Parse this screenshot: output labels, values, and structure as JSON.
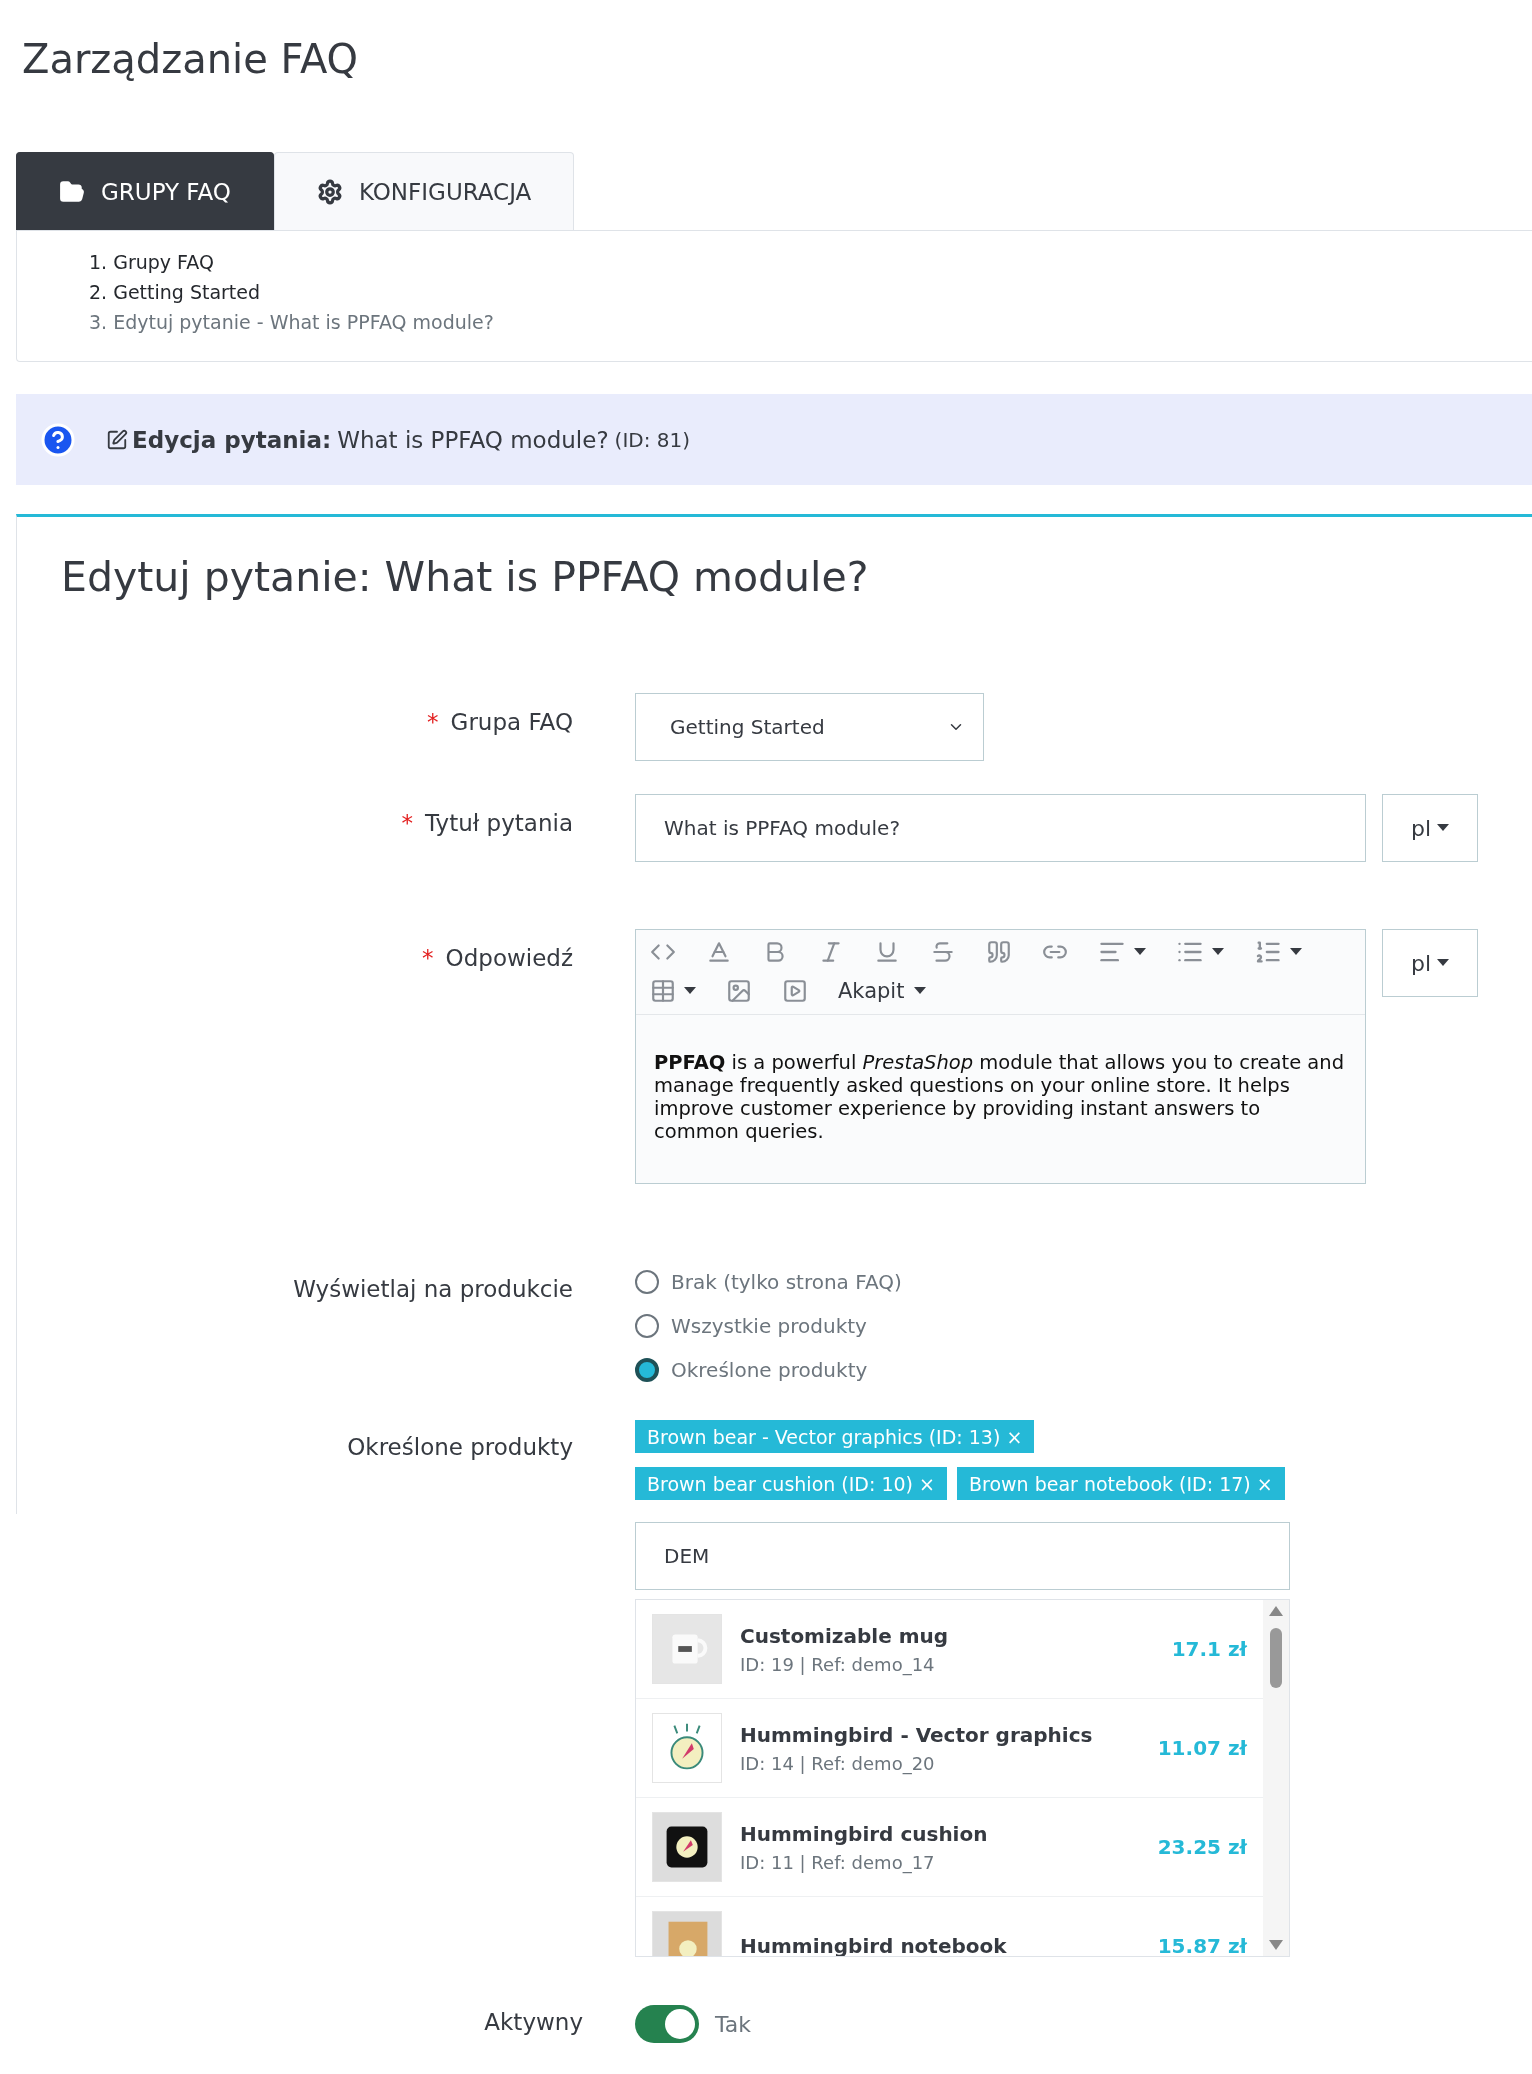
{
  "page_title": "Zarządzanie FAQ",
  "tabs": [
    {
      "label": "GRUPY FAQ",
      "selected": true
    },
    {
      "label": "KONFIGURACJA",
      "selected": false
    }
  ],
  "breadcrumb": [
    {
      "label": "1. Grupy FAQ",
      "current": false
    },
    {
      "label": "2. Getting Started",
      "current": false
    },
    {
      "label": "3. Edytuj pytanie - What is PPFAQ module?",
      "current": true
    }
  ],
  "info_banner": {
    "label": "Edycja pytania:",
    "title": "What is PPFAQ module?",
    "id": "(ID: 81)"
  },
  "form": {
    "heading": "Edytuj pytanie: What is PPFAQ module?",
    "group_field": {
      "label": "Grupa FAQ",
      "required_mark": "*",
      "value": "Getting Started"
    },
    "title_field": {
      "label": "Tytuł pytania",
      "required_mark": "*",
      "value": "What is PPFAQ module?",
      "language": "pl"
    },
    "answer_field": {
      "label": "Odpowiedź",
      "required_mark": "*",
      "format": "Akapit",
      "content": "**PPFAQ** is a powerful *PrestaShop* module that allows you to create and manage frequently asked questions on your online store. It helps improve customer experience by providing instant answers to common queries.",
      "language": "pl"
    },
    "display_field": {
      "label": "Wyświetlaj na produkcie",
      "options": [
        {
          "label": "Brak (tylko strona FAQ)",
          "selected": false
        },
        {
          "label": "Wszystkie produkty",
          "selected": false
        },
        {
          "label": "Określone produkty",
          "selected": true
        }
      ]
    },
    "products_field": {
      "label": "Określone produkty",
      "tags": [
        {
          "label": "Brown bear - Vector graphics (ID: 13)",
          "remove": "×"
        },
        {
          "label": "Brown bear cushion (ID: 10)",
          "remove": "×"
        },
        {
          "label": "Brown bear notebook (ID: 17)",
          "remove": "×"
        }
      ],
      "search": "DEM",
      "results": [
        {
          "name": "Customizable mug",
          "meta": "ID: 19 | Ref: demo_14",
          "price": "17.1 zł"
        },
        {
          "name": "Hummingbird - Vector graphics",
          "meta": "ID: 14 | Ref: demo_20",
          "price": "11.07 zł"
        },
        {
          "name": "Hummingbird cushion",
          "meta": "ID: 11 | Ref: demo_17",
          "price": "23.25 zł"
        },
        {
          "name": "Hummingbird notebook",
          "price": "15.87 zł"
        }
      ]
    },
    "active_field": {
      "label": "Aktywny",
      "on": true,
      "text": "Tak"
    }
  }
}
